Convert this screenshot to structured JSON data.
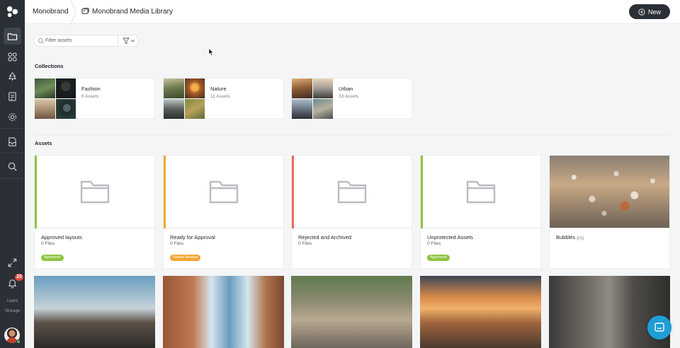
{
  "app": {
    "name": "Monobrand"
  },
  "header": {
    "breadcrumb_root": "Monobrand",
    "current_page": "Monobrand Media Library",
    "new_button_label": "New"
  },
  "sidebar": {
    "items": [
      {
        "icon": "folder-icon",
        "active": true
      },
      {
        "icon": "grid-shapes-icon",
        "active": false
      },
      {
        "icon": "tree-icon",
        "active": false
      },
      {
        "icon": "checklist-icon",
        "active": false
      },
      {
        "icon": "gear-icon",
        "active": false
      },
      {
        "icon": "inbox-icon",
        "active": false
      },
      {
        "icon": "search-icon",
        "active": false
      }
    ],
    "expand_icon": "expand-icon",
    "notification_icon": "bell-icon",
    "notification_count": "20",
    "users_label": "Users",
    "storage_label": "Storage"
  },
  "filter": {
    "placeholder": "Filter assets"
  },
  "collections": {
    "title": "Collections",
    "items": [
      {
        "name": "Fashion",
        "count": "6 Assets"
      },
      {
        "name": "Nature",
        "count": "11 Assets"
      },
      {
        "name": "Urban",
        "count": "33 Assets"
      }
    ]
  },
  "assets": {
    "title": "Assets",
    "items": [
      {
        "name": "Approved layouts",
        "files": "0 Files",
        "status": "Approved",
        "status_color": "#8cc63e"
      },
      {
        "name": "Ready for Approval",
        "files": "0 Files",
        "status": "Needs Review",
        "status_color": "#f4a532"
      },
      {
        "name": "Rejected and Archived",
        "files": "0 Files",
        "status": "",
        "status_color": "#e86a5a"
      },
      {
        "name": "Unprotected Assets",
        "files": "0 Files",
        "status": "Approved",
        "status_color": "#8cc63e"
      },
      {
        "name": "Bubbles",
        "ext": ".jpg"
      }
    ]
  },
  "colors": {
    "sidebar_bg": "#2b3036",
    "accent_approved": "#8cc63e",
    "accent_review": "#f4a532",
    "accent_rejected": "#e86a5a",
    "chat_button": "#1e9ed6"
  }
}
